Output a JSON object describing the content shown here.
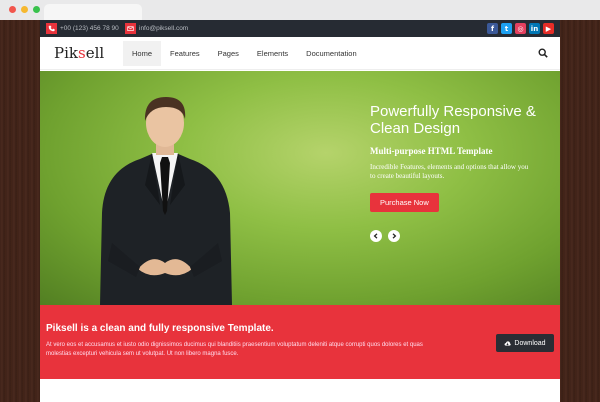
{
  "topbar": {
    "phone": "+00 (123) 456 78 90",
    "email": "info@piksell.com",
    "social_icons": [
      {
        "name": "facebook-icon",
        "glyph": "f",
        "color": "#3b5998"
      },
      {
        "name": "twitter-icon",
        "glyph": "t",
        "color": "#1da1f2"
      },
      {
        "name": "instagram-icon",
        "glyph": "◎",
        "color": "#e4405f"
      },
      {
        "name": "linkedin-icon",
        "glyph": "in",
        "color": "#0077b5"
      },
      {
        "name": "youtube-icon",
        "glyph": "▶",
        "color": "#e52d27"
      }
    ]
  },
  "logo": {
    "prefix": "Pik",
    "accent": "s",
    "suffix": "ell"
  },
  "nav": {
    "items": [
      "Home",
      "Features",
      "Pages",
      "Elements",
      "Documentation"
    ],
    "active": "Home"
  },
  "hero": {
    "title": "Powerfully Responsive & Clean Design",
    "subtitle": "Multi-purpose HTML Template",
    "description": "Incredible Features, elements and options that allow you to create beautiful layouts.",
    "button": "Purchase Now"
  },
  "promo": {
    "title": "Piksell is a clean and fully responsive Template.",
    "description": "At vero eos et accusamus et iusto odio dignissimos ducimus qui blanditiis praesentium voluptatum deleniti atque corrupti quos dolores et quas molestias excepturi vehicula sem ut volutpat. Ut non libero magna fusce.",
    "button": "Download"
  },
  "colors": {
    "accent": "#e8333c",
    "topbar": "#262b33",
    "hero_green": "#8fbf45"
  }
}
